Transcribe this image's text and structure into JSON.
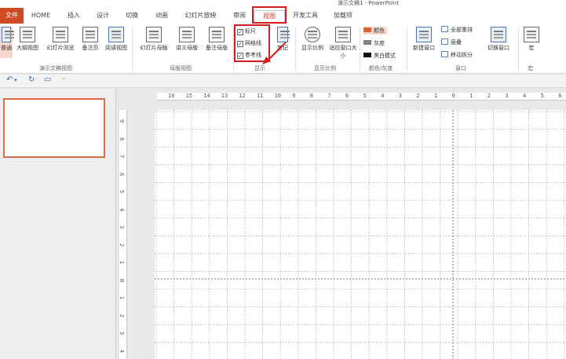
{
  "window": {
    "title": "演示文稿1 - PowerPoint"
  },
  "tabs": [
    "文件",
    "HOME",
    "插入",
    "设计",
    "切换",
    "动画",
    "幻灯片放映",
    "审阅",
    "视图",
    "开发工具",
    "加载项"
  ],
  "active_tab": "视图",
  "ribbon": {
    "presentation_views": {
      "buttons": [
        "普通",
        "大纲视图",
        "幻灯片浏览",
        "备注页",
        "阅读视图"
      ],
      "group_label": "演示文稿视图"
    },
    "master_views": {
      "buttons": [
        "幻灯片母版",
        "讲义母版",
        "备注母版"
      ],
      "group_label": "母版视图"
    },
    "show": {
      "checkboxes": [
        {
          "label": "标尺",
          "checked": true
        },
        {
          "label": "网格线",
          "checked": true
        },
        {
          "label": "参考线",
          "checked": true
        }
      ],
      "notes_label": "笔记",
      "group_label": "显示"
    },
    "zoom": {
      "buttons": [
        "显示比例",
        "适应窗口大小"
      ],
      "group_label": "显示比例"
    },
    "color": {
      "options": [
        "颜色",
        "灰度",
        "黑白模式"
      ],
      "swatch_colors": [
        "#d9642d",
        "#808080",
        "#111111"
      ],
      "group_label": "颜色/灰度"
    },
    "window": {
      "new_window_label": "新建窗口",
      "small_buttons": [
        "全部重排",
        "层叠",
        "移动拆分"
      ],
      "switch_label": "切换窗口",
      "group_label": "窗口"
    },
    "macro": {
      "label": "宏",
      "group_label": "宏"
    }
  },
  "ruler": {
    "horizontal_labels": [
      "16",
      "15",
      "14",
      "13",
      "12",
      "11",
      "10",
      "9",
      "8",
      "7",
      "6",
      "5",
      "4",
      "3",
      "2",
      "1",
      "0",
      "1",
      "2",
      "3",
      "4",
      "5",
      "6"
    ],
    "vertical_labels": [
      "9",
      "8",
      "7",
      "6",
      "5",
      "4",
      "3",
      "2",
      "1",
      "0",
      "1",
      "2",
      "3",
      "4"
    ]
  },
  "colors": {
    "file_tab": "#d04a26",
    "highlight_box": "#d21e1e",
    "thumbnail_border": "#d96a4a",
    "selected_button": "#f8d7cc"
  }
}
